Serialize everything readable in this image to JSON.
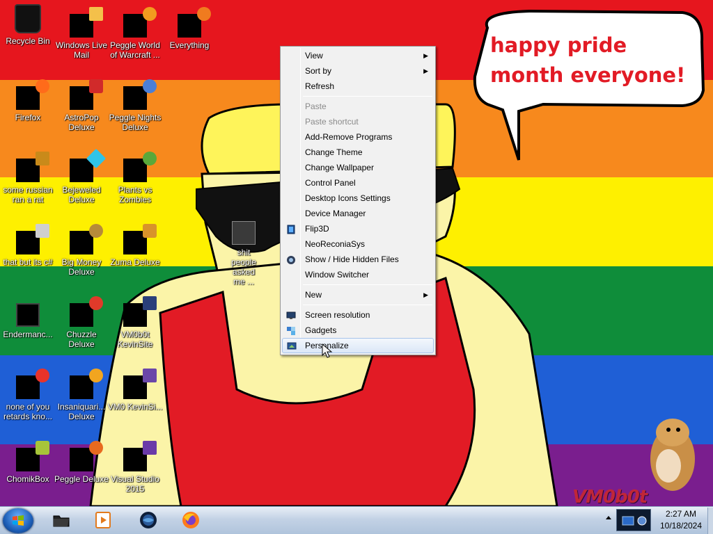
{
  "wallpaper": {
    "speech_bubble_text": "happy pride month everyone!",
    "watermark": "VM0b0t",
    "stripe_colors": [
      "#e6161e",
      "#f7891d",
      "#fef000",
      "#0f8d3a",
      "#1f5fd6",
      "#7a1e8e"
    ]
  },
  "desktop_icons": [
    {
      "id": "recycle-bin",
      "label": "Recycle Bin",
      "icon": "recycle-bin-icon"
    },
    {
      "id": "windows-live-mail",
      "label": "Windows Live Mail",
      "icon": "mail-icon"
    },
    {
      "id": "peggle-world-of-warcraft",
      "label": "Peggle World of Warcraft ...",
      "icon": "peggle-icon"
    },
    {
      "id": "everything",
      "label": "Everything",
      "icon": "search-icon"
    },
    {
      "id": "firefox",
      "label": "Firefox",
      "icon": "firefox-icon"
    },
    {
      "id": "astropop-deluxe",
      "label": "AstroPop Deluxe",
      "icon": "astropop-icon"
    },
    {
      "id": "peggle-nights-deluxe",
      "label": "Peggle Nights Deluxe",
      "icon": "peggle-nights-icon"
    },
    {
      "id": "some-russian-ran-a-rat",
      "label": "some russian ran a rat",
      "icon": "app-icon"
    },
    {
      "id": "bejeweled-deluxe",
      "label": "Bejeweled Deluxe",
      "icon": "gem-icon"
    },
    {
      "id": "plants-vs-zombies",
      "label": "Plants vs Zombies",
      "icon": "plant-icon"
    },
    {
      "id": "shit-people-asked-me",
      "label": "shit people asked me ...",
      "icon": "folder-icon"
    },
    {
      "id": "that-but-its-c",
      "label": "that but its c#",
      "icon": "app-icon"
    },
    {
      "id": "big-money-deluxe",
      "label": "Big Money Deluxe",
      "icon": "money-bag-icon"
    },
    {
      "id": "zuma-deluxe",
      "label": "Zuma Deluxe",
      "icon": "zuma-icon"
    },
    {
      "id": "endermanc",
      "label": "Endermanc...",
      "icon": "app-icon"
    },
    {
      "id": "chuzzle-deluxe",
      "label": "Chuzzle Deluxe",
      "icon": "chuzzle-icon"
    },
    {
      "id": "vm0b0t-kevinsite",
      "label": "VM0b0t KevinSite",
      "icon": "app-icon"
    },
    {
      "id": "none-of-you-retards",
      "label": "none of you retards kno...",
      "icon": "app-icon"
    },
    {
      "id": "insaniquarium-deluxe",
      "label": "Insaniquari... Deluxe",
      "icon": "fish-icon"
    },
    {
      "id": "vm0-kevinsi",
      "label": "VM0 KevinSi...",
      "icon": "app-icon"
    },
    {
      "id": "chomikbox",
      "label": "ChomikBox",
      "icon": "chomikbox-icon"
    },
    {
      "id": "peggle-deluxe",
      "label": "Peggle Deluxe",
      "icon": "peggle-icon"
    },
    {
      "id": "visual-studio-2015",
      "label": "Visual Studio 2015",
      "icon": "visual-studio-icon"
    }
  ],
  "context_menu": {
    "items": [
      {
        "label": "View",
        "submenu": true
      },
      {
        "label": "Sort by",
        "submenu": true
      },
      {
        "label": "Refresh"
      },
      {
        "label": "Paste",
        "disabled": true
      },
      {
        "label": "Paste shortcut",
        "disabled": true
      },
      {
        "label": "Add-Remove Programs"
      },
      {
        "label": "Change Theme"
      },
      {
        "label": "Change Wallpaper"
      },
      {
        "label": "Control Panel"
      },
      {
        "label": "Desktop Icons Settings"
      },
      {
        "label": "Device Manager"
      },
      {
        "label": "Flip3D",
        "icon": "flip3d-icon"
      },
      {
        "label": "NeoReconiaSys"
      },
      {
        "label": "Show / Hide Hidden Files",
        "icon": "hidden-files-icon"
      },
      {
        "label": "Window Switcher"
      },
      {
        "label": "New",
        "submenu": true
      },
      {
        "label": "Screen resolution",
        "icon": "monitor-icon"
      },
      {
        "label": "Gadgets",
        "icon": "gadgets-icon"
      },
      {
        "label": "Personalize",
        "icon": "personalize-icon",
        "hovered": true
      }
    ]
  },
  "taskbar": {
    "pinned": [
      {
        "name": "explorer",
        "icon": "folder-icon"
      },
      {
        "name": "media-player",
        "icon": "media-player-icon"
      },
      {
        "name": "globe",
        "icon": "globe-icon"
      },
      {
        "name": "firefox",
        "icon": "firefox-icon"
      }
    ],
    "clock_time": "2:27 AM",
    "clock_date": "10/18/2024"
  }
}
